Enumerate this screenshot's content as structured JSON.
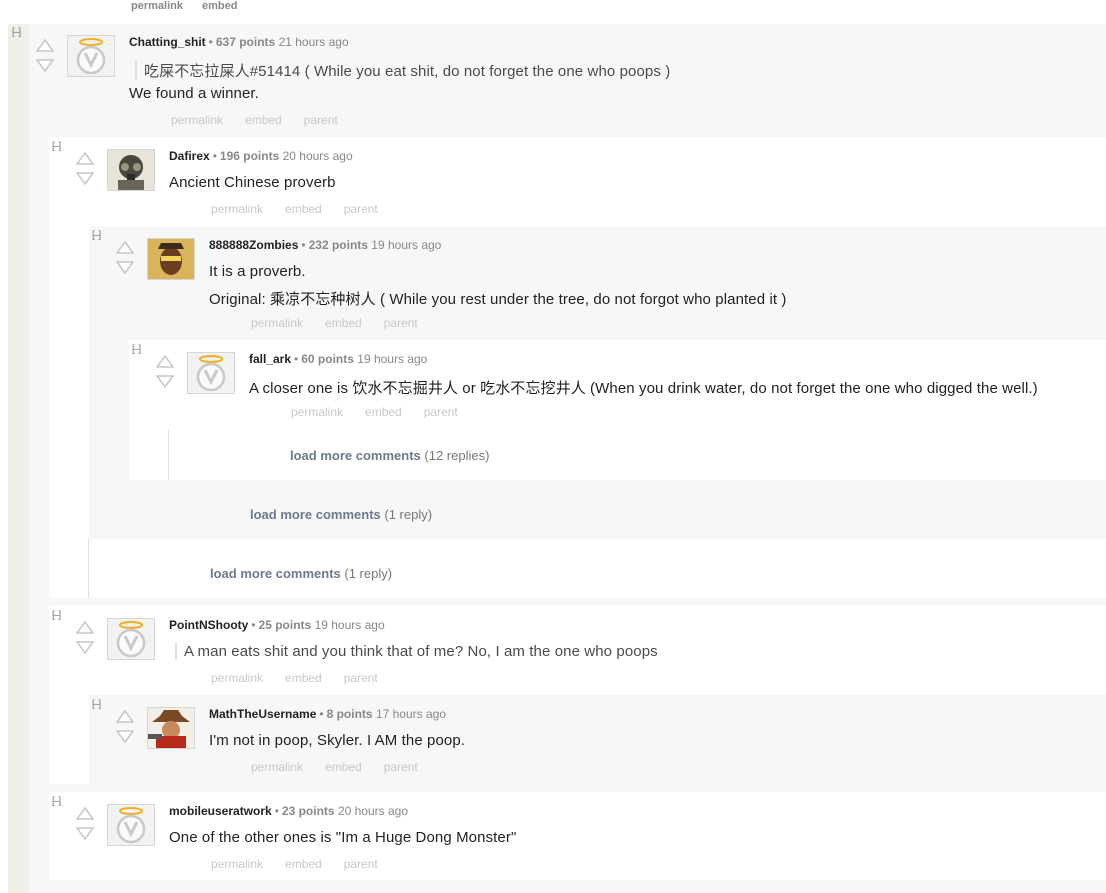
{
  "top_actions": [
    "permalink",
    "embed"
  ],
  "collapse_symbol": "[–]",
  "action_labels": {
    "permalink": "permalink",
    "embed": "embed",
    "parent": "parent"
  },
  "comments": {
    "c1": {
      "author": "Chatting_shit",
      "score": "637 points",
      "time": "21 hours ago",
      "quote": "吃屎不忘拉屎人#51414 ( While you eat shit, do not forget the one who poops )",
      "text": "We found a winner."
    },
    "c2": {
      "author": "Dafirex",
      "score": "196 points",
      "time": "20 hours ago",
      "text": "Ancient Chinese proverb"
    },
    "c3": {
      "author": "888888Zombies",
      "score": "232 points",
      "time": "19 hours ago",
      "text": "It is a proverb.",
      "text2": "Original: 乘凉不忘种树人 ( While you rest under the tree, do not forgot who planted it )"
    },
    "c4": {
      "author": "fall_ark",
      "score": "60 points",
      "time": "19 hours ago",
      "text": "A closer one is 饮水不忘掘井人 or 吃水不忘挖井人 (When you drink water, do not forget the one who digged the well.)"
    },
    "c5": {
      "author": "PointNShooty",
      "score": "25 points",
      "time": "19 hours ago",
      "quote": "A man eats shit and you think that of me? No, I am the one who poops"
    },
    "c6": {
      "author": "MathTheUsername",
      "score": "8 points",
      "time": "17 hours ago",
      "text": "I'm not in poop, Skyler. I AM the poop."
    },
    "c7": {
      "author": "mobileuseratwork",
      "score": "23 points",
      "time": "20 hours ago",
      "text": "One of the other ones is \"Im a Huge Dong Monster\""
    }
  },
  "load_more": {
    "label": "load more comments",
    "m1": "(12 replies)",
    "m2": "(1 reply)",
    "m3": "(1 reply)"
  },
  "icons": {
    "upvote": "upvote-arrow-icon",
    "downvote": "downvote-arrow-icon",
    "avatar_default": "overwatch-logo-icon"
  }
}
